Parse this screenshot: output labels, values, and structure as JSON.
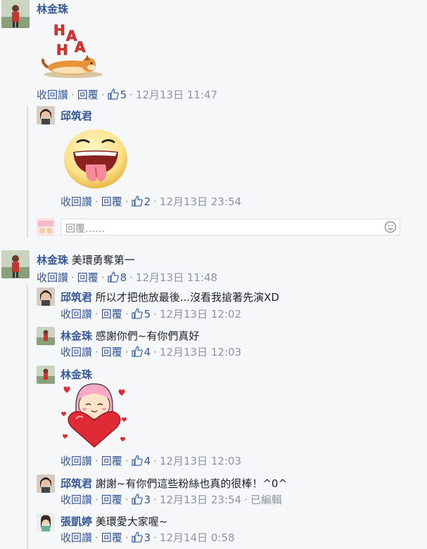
{
  "comments": [
    {
      "name": "林金珠",
      "text": "",
      "like_label": "收回讚",
      "reply_label": "回覆",
      "likes": "5",
      "time": "12月13日 11:47"
    },
    {
      "name": "邱筑君",
      "text": "",
      "like_label": "收回讚",
      "reply_label": "回覆",
      "likes": "2",
      "time": "12月13日 23:54"
    },
    {
      "name": "林金珠",
      "text": "美環勇奪第一",
      "like_label": "收回讚",
      "reply_label": "回覆",
      "likes": "8",
      "time": "12月13日 11:48"
    },
    {
      "name": "邱筑君",
      "text": "所以才把他放最後...沒看我搶著先演XD",
      "like_label": "收回讚",
      "reply_label": "回覆",
      "likes": "5",
      "time": "12月13日 12:02"
    },
    {
      "name": "林金珠",
      "text": "感謝你們~有你們真好",
      "like_label": "收回讚",
      "reply_label": "回覆",
      "likes": "4",
      "time": "12月13日 12:03"
    },
    {
      "name": "林金珠",
      "text": "",
      "like_label": "收回讚",
      "reply_label": "回覆",
      "likes": "4",
      "time": "12月13日 12:03"
    },
    {
      "name": "邱筑君",
      "text": "謝謝~有你們這些粉絲也真的很棒！^0^",
      "like_label": "收回讚",
      "reply_label": "回覆",
      "likes": "3",
      "time": "12月13日 23:54",
      "edited": "已編輯"
    },
    {
      "name": "張凱婷",
      "text": "美環愛大家喔~",
      "like_label": "收回讚",
      "reply_label": "回覆",
      "likes": "3",
      "time": "12月14日 0:58"
    }
  ],
  "reply_input": {
    "placeholder": "回覆……"
  },
  "stickers": {
    "haha": "HAHA",
    "haha_letters": [
      "H",
      "A",
      "H",
      "A"
    ]
  },
  "colors": {
    "link": "#365899",
    "meta": "#90949c",
    "background": "#f6f7f9"
  }
}
